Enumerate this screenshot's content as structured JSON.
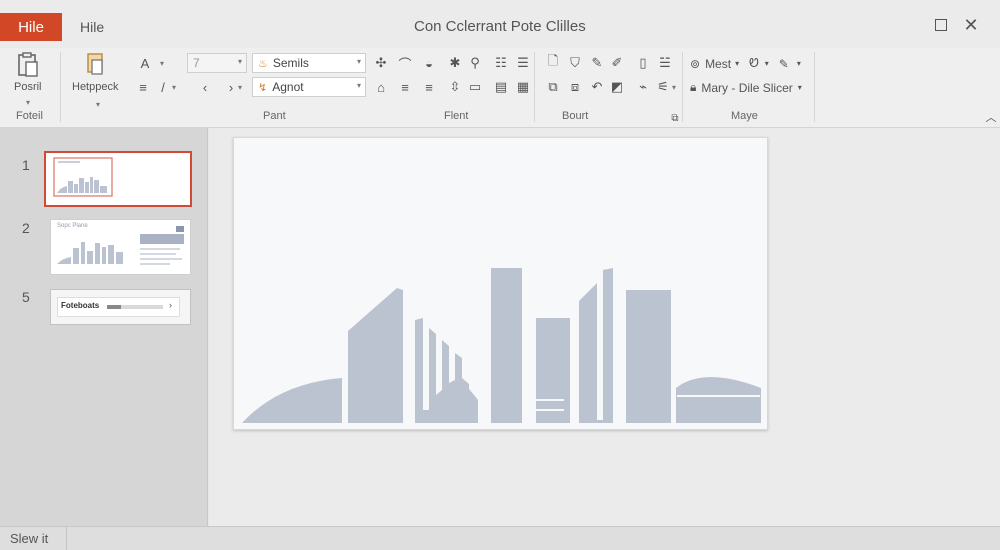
{
  "titlebar": {
    "file_tab": "Hile",
    "home_tab": "Hile",
    "title": "Con Cclerrant Pote Clilles",
    "accent": "#d24726"
  },
  "ribbon": {
    "foteil": {
      "button_label": "Posril",
      "group_label": "Foteil"
    },
    "pant": {
      "button_label": "Hetppeck",
      "font_size_value": "7",
      "font_name": "Semils",
      "font_name2": "Agnot",
      "group_label": "Pant"
    },
    "flent": {
      "group_label": "Flent"
    },
    "bourt": {
      "group_label": "Bourt"
    },
    "maye": {
      "item1": "Mest",
      "item2": "Mary - Dile Slicer",
      "group_label": "Maye"
    }
  },
  "slides": [
    {
      "number": "1",
      "selected": true
    },
    {
      "number": "2",
      "title_text": "Sopc Plane",
      "selected": false
    },
    {
      "number": "5",
      "label": "Foteboats",
      "selected": false
    }
  ],
  "status": {
    "text": "Slew it"
  },
  "colors": {
    "buildings": "#bcc3d0",
    "slide_bg": "#f7f8f9",
    "selection": "#d04a36"
  }
}
